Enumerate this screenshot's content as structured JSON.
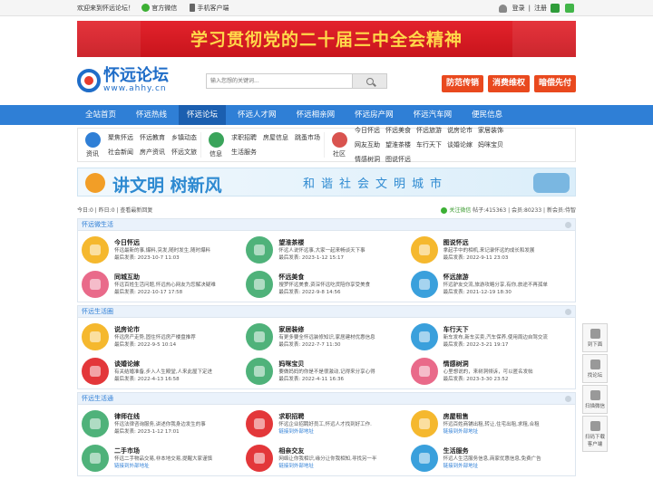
{
  "topbar": {
    "welcome": "欢迎来到怀远论坛！",
    "wechat": "官方微信",
    "mobile": "手机客户端",
    "login": "登录",
    "register": "注册"
  },
  "banner": {
    "text": "学习贯彻党的二十届三中全会精神"
  },
  "logo": {
    "name": "怀远论坛",
    "url": "www.ahhy.cn"
  },
  "search": {
    "placeholder": "输入您想的关键词..."
  },
  "chips": [
    "防范传销",
    "消费维权",
    "暗偿先付"
  ],
  "nav": {
    "active_index": 2,
    "items": [
      "全站首页",
      "怀远热线",
      "怀远论坛",
      "怀远人才网",
      "怀远相亲网",
      "怀远房产网",
      "怀远汽车网",
      "便民信息"
    ]
  },
  "categories": [
    {
      "label": "资讯",
      "color": "#2f7fd6",
      "links": [
        "聚焦怀远",
        "怀远教育",
        "乡镇动态",
        "社会新闻",
        "房产资讯",
        "怀远文旅"
      ]
    },
    {
      "label": "信息",
      "color": "#3aa45b",
      "links": [
        "求职招聘",
        "房屋信息",
        "跳蚤市场",
        "生活服务"
      ]
    },
    {
      "label": "社区",
      "color": "#d9534f",
      "links": [
        "今日怀远",
        "怀远美食",
        "怀远旅游",
        "说房论市",
        "家居装饰",
        "网友互助",
        "望淮茶楼",
        "车行天下",
        "谈婚论嫁",
        "妈咪宝贝",
        "情感树洞",
        "图说怀远"
      ]
    }
  ],
  "ad": {
    "big": "讲文明 树新风",
    "small": "和谐社会文明城市"
  },
  "stats": {
    "left": "今日:0 | 昨日:0 | 查看最新回复",
    "wechat": "关注微信",
    "right": "帖子:415363 | 会员:80233 | 新会员:侍智"
  },
  "sections": [
    {
      "title": "怀远微生活",
      "forums": [
        {
          "name": "今日怀远",
          "desc": "怀远最新的事,爆料,突发,随时发生,随时爆料",
          "meta": "最后发表: 2023-10-7 11:03",
          "color": "#f5b82e"
        },
        {
          "name": "望淮茶楼",
          "desc": "怀远人说怀远事,大家一起来畅谈天下事",
          "meta": "最后发表: 2023-1-12 15:17",
          "color": "#4fb27a"
        },
        {
          "name": "图说怀远",
          "desc": "拿起手中的相机,来记录怀远的成长和发展",
          "meta": "最后发表: 2022-9-11 23:03",
          "color": "#f5b82e"
        },
        {
          "name": "同城互助",
          "desc": "怀远百姓生活问题,怀远热心网友为您解决疑难",
          "meta": "最后发表: 2022-10-17 17:58",
          "color": "#e96a8a"
        },
        {
          "name": "怀远美食",
          "desc": "搜罗怀远美食,资深怀远吃货陪你享受美食",
          "meta": "最后发表: 2022-9-8 14:56",
          "color": "#4fb27a"
        },
        {
          "name": "怀远旅游",
          "desc": "怀远驴友交流,旅游攻略分享,有你,旅途不再孤单",
          "meta": "最后发表: 2021-12-19 18:30",
          "color": "#3aa0dc"
        }
      ]
    },
    {
      "title": "怀远生活圈",
      "forums": [
        {
          "name": "说房论市",
          "desc": "怀远房产走势,固住怀远房产楼盘推荐",
          "meta": "最后发表: 2022-9-5 10:14",
          "color": "#f5b82e"
        },
        {
          "name": "家居装修",
          "desc": "有更多要全怀远装修知识,家居建材优惠信息",
          "meta": "最后发表: 2022-7-7 11:30",
          "color": "#4fb27a"
        },
        {
          "name": "车行天下",
          "desc": "新车发布,新车买卖,汽车保养,使用周边自驾交流",
          "meta": "最后发表: 2022-3-21 19:17",
          "color": "#3aa0dc"
        },
        {
          "name": "谈婚论嫁",
          "desc": "有关结婚准备,步入人生殿堂,人来此屋下定进",
          "meta": "最后发表: 2022-4-13 16:58",
          "color": "#e3373a"
        },
        {
          "name": "妈咪宝贝",
          "desc": "要做妈妈的你是不是很激动,记得来分享心得",
          "meta": "最后发表: 2022-4-11 16:36",
          "color": "#4fb27a"
        },
        {
          "name": "情感树洞",
          "desc": "心里想说的，来树洞倾诉，可以匿名发帖",
          "meta": "最后发表: 2023-3-30 23:52",
          "color": "#e96a8a"
        }
      ]
    },
    {
      "title": "怀远生活通",
      "forums": [
        {
          "name": "律师在线",
          "desc": "怀远法律咨询服务,讲述你我身边发生的事",
          "meta": "最后发表: 2023-1-12 17:01",
          "color": "#4fb27a",
          "link": false
        },
        {
          "name": "求职招聘",
          "desc": "怀远企业招聘好员工,怀远人才找到好工作.",
          "meta": "链接到外部地址",
          "color": "#e3373a",
          "link": true
        },
        {
          "name": "房屋租售",
          "desc": "怀远百姓商铺出租,转让,住宅出租,求租,合租",
          "meta": "链接到外部地址",
          "color": "#f5b82e",
          "link": true
        },
        {
          "name": "二手市场",
          "desc": "怀远二手物品交易,非本地交易,提醒大家谨慎",
          "meta": "链接到外部地址",
          "color": "#4fb27a",
          "link": true
        },
        {
          "name": "相亲交友",
          "desc": "网络让你我相识,缘分让你我相知,寻找另一半",
          "meta": "链接到外部地址",
          "color": "#e3373a",
          "link": true
        },
        {
          "name": "生活服务",
          "desc": "怀远人生活服务信息,商家优惠信息,免费广告",
          "meta": "链接到外部地址",
          "color": "#3aa0dc",
          "link": true
        }
      ]
    }
  ],
  "side": [
    "到下面",
    "找论坛",
    "扫描微信",
    "扫码下载客户端"
  ]
}
